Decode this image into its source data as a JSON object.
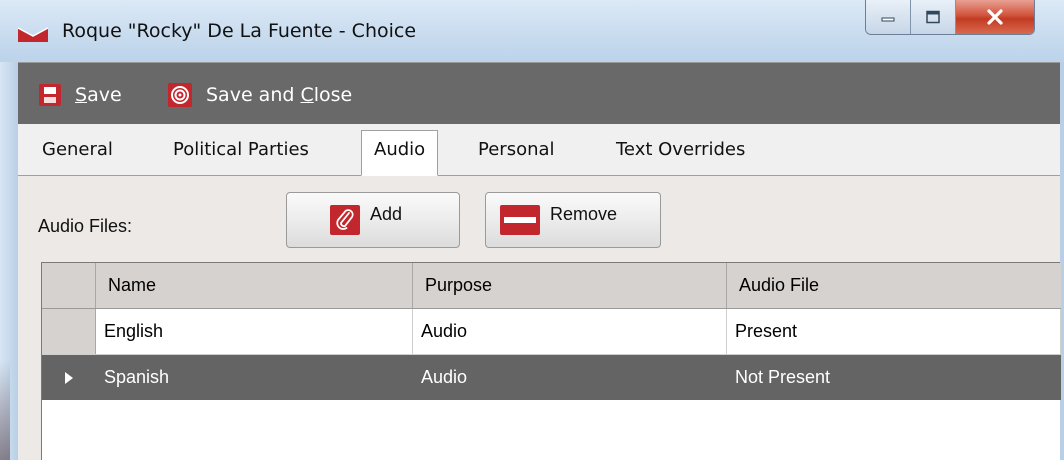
{
  "window": {
    "title": "Roque \"Rocky\" De La Fuente - Choice",
    "controls": [
      "minimize-icon",
      "maximize-icon",
      "close-icon"
    ]
  },
  "toolbar": {
    "save": {
      "pre": "",
      "key": "S",
      "post": "ave",
      "icon": "floppy-disk-icon"
    },
    "save_close": {
      "pre": "Save and ",
      "key": "C",
      "post": "lose",
      "icon": "target-icon"
    }
  },
  "tabs": [
    {
      "label": "General",
      "active": false
    },
    {
      "label": "Political Parties",
      "active": false
    },
    {
      "label": "Audio",
      "active": true
    },
    {
      "label": "Personal",
      "active": false
    },
    {
      "label": "Text Overrides",
      "active": false
    }
  ],
  "audio": {
    "label": "Audio Files:",
    "add_label": "Add",
    "remove_label": "Remove"
  },
  "grid": {
    "columns": [
      "Name",
      "Purpose",
      "Audio File"
    ],
    "rows": [
      {
        "name": "English",
        "purpose": "Audio",
        "audio_file": "Present",
        "selected": false
      },
      {
        "name": "Spanish",
        "purpose": "Audio",
        "audio_file": "Not Present",
        "selected": true
      }
    ]
  },
  "colors": {
    "toolbar_bg": "#696969",
    "selected_row_bg": "#646464",
    "accent_red": "#c1272d"
  }
}
